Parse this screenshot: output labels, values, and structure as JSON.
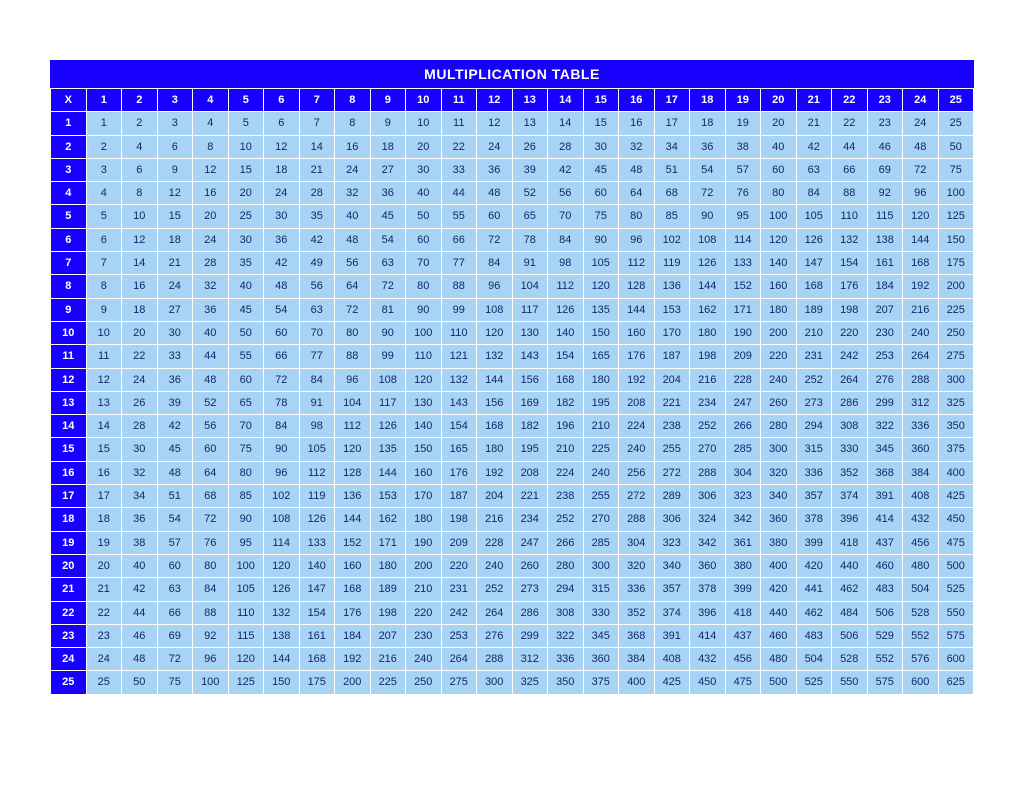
{
  "title": "MULTIPLICATION TABLE",
  "corner_label": "X",
  "size": 25,
  "chart_data": {
    "type": "table",
    "title": "MULTIPLICATION TABLE",
    "row_headers": [
      1,
      2,
      3,
      4,
      5,
      6,
      7,
      8,
      9,
      10,
      11,
      12,
      13,
      14,
      15,
      16,
      17,
      18,
      19,
      20,
      21,
      22,
      23,
      24,
      25
    ],
    "col_headers": [
      1,
      2,
      3,
      4,
      5,
      6,
      7,
      8,
      9,
      10,
      11,
      12,
      13,
      14,
      15,
      16,
      17,
      18,
      19,
      20,
      21,
      22,
      23,
      24,
      25
    ],
    "values": [
      [
        1,
        2,
        3,
        4,
        5,
        6,
        7,
        8,
        9,
        10,
        11,
        12,
        13,
        14,
        15,
        16,
        17,
        18,
        19,
        20,
        21,
        22,
        23,
        24,
        25
      ],
      [
        2,
        4,
        6,
        8,
        10,
        12,
        14,
        16,
        18,
        20,
        22,
        24,
        26,
        28,
        30,
        32,
        34,
        36,
        38,
        40,
        42,
        44,
        46,
        48,
        50
      ],
      [
        3,
        6,
        9,
        12,
        15,
        18,
        21,
        24,
        27,
        30,
        33,
        36,
        39,
        42,
        45,
        48,
        51,
        54,
        57,
        60,
        63,
        66,
        69,
        72,
        75
      ],
      [
        4,
        8,
        12,
        16,
        20,
        24,
        28,
        32,
        36,
        40,
        44,
        48,
        52,
        56,
        60,
        64,
        68,
        72,
        76,
        80,
        84,
        88,
        92,
        96,
        100
      ],
      [
        5,
        10,
        15,
        20,
        25,
        30,
        35,
        40,
        45,
        50,
        55,
        60,
        65,
        70,
        75,
        80,
        85,
        90,
        95,
        100,
        105,
        110,
        115,
        120,
        125
      ],
      [
        6,
        12,
        18,
        24,
        30,
        36,
        42,
        48,
        54,
        60,
        66,
        72,
        78,
        84,
        90,
        96,
        102,
        108,
        114,
        120,
        126,
        132,
        138,
        144,
        150
      ],
      [
        7,
        14,
        21,
        28,
        35,
        42,
        49,
        56,
        63,
        70,
        77,
        84,
        91,
        98,
        105,
        112,
        119,
        126,
        133,
        140,
        147,
        154,
        161,
        168,
        175
      ],
      [
        8,
        16,
        24,
        32,
        40,
        48,
        56,
        64,
        72,
        80,
        88,
        96,
        104,
        112,
        120,
        128,
        136,
        144,
        152,
        160,
        168,
        176,
        184,
        192,
        200
      ],
      [
        9,
        18,
        27,
        36,
        45,
        54,
        63,
        72,
        81,
        90,
        99,
        108,
        117,
        126,
        135,
        144,
        153,
        162,
        171,
        180,
        189,
        198,
        207,
        216,
        225
      ],
      [
        10,
        20,
        30,
        40,
        50,
        60,
        70,
        80,
        90,
        100,
        110,
        120,
        130,
        140,
        150,
        160,
        170,
        180,
        190,
        200,
        210,
        220,
        230,
        240,
        250
      ],
      [
        11,
        22,
        33,
        44,
        55,
        66,
        77,
        88,
        99,
        110,
        121,
        132,
        143,
        154,
        165,
        176,
        187,
        198,
        209,
        220,
        231,
        242,
        253,
        264,
        275
      ],
      [
        12,
        24,
        36,
        48,
        60,
        72,
        84,
        96,
        108,
        120,
        132,
        144,
        156,
        168,
        180,
        192,
        204,
        216,
        228,
        240,
        252,
        264,
        276,
        288,
        300
      ],
      [
        13,
        26,
        39,
        52,
        65,
        78,
        91,
        104,
        117,
        130,
        143,
        156,
        169,
        182,
        195,
        208,
        221,
        234,
        247,
        260,
        273,
        286,
        299,
        312,
        325
      ],
      [
        14,
        28,
        42,
        56,
        70,
        84,
        98,
        112,
        126,
        140,
        154,
        168,
        182,
        196,
        210,
        224,
        238,
        252,
        266,
        280,
        294,
        308,
        322,
        336,
        350
      ],
      [
        15,
        30,
        45,
        60,
        75,
        90,
        105,
        120,
        135,
        150,
        165,
        180,
        195,
        210,
        225,
        240,
        255,
        270,
        285,
        300,
        315,
        330,
        345,
        360,
        375
      ],
      [
        16,
        32,
        48,
        64,
        80,
        96,
        112,
        128,
        144,
        160,
        176,
        192,
        208,
        224,
        240,
        256,
        272,
        288,
        304,
        320,
        336,
        352,
        368,
        384,
        400
      ],
      [
        17,
        34,
        51,
        68,
        85,
        102,
        119,
        136,
        153,
        170,
        187,
        204,
        221,
        238,
        255,
        272,
        289,
        306,
        323,
        340,
        357,
        374,
        391,
        408,
        425
      ],
      [
        18,
        36,
        54,
        72,
        90,
        108,
        126,
        144,
        162,
        180,
        198,
        216,
        234,
        252,
        270,
        288,
        306,
        324,
        342,
        360,
        378,
        396,
        414,
        432,
        450
      ],
      [
        19,
        38,
        57,
        76,
        95,
        114,
        133,
        152,
        171,
        190,
        209,
        228,
        247,
        266,
        285,
        304,
        323,
        342,
        361,
        380,
        399,
        418,
        437,
        456,
        475
      ],
      [
        20,
        40,
        60,
        80,
        100,
        120,
        140,
        160,
        180,
        200,
        220,
        240,
        260,
        280,
        300,
        320,
        340,
        360,
        380,
        400,
        420,
        440,
        460,
        480,
        500
      ],
      [
        21,
        42,
        63,
        84,
        105,
        126,
        147,
        168,
        189,
        210,
        231,
        252,
        273,
        294,
        315,
        336,
        357,
        378,
        399,
        420,
        441,
        462,
        483,
        504,
        525
      ],
      [
        22,
        44,
        66,
        88,
        110,
        132,
        154,
        176,
        198,
        220,
        242,
        264,
        286,
        308,
        330,
        352,
        374,
        396,
        418,
        440,
        462,
        484,
        506,
        528,
        550
      ],
      [
        23,
        46,
        69,
        92,
        115,
        138,
        161,
        184,
        207,
        230,
        253,
        276,
        299,
        322,
        345,
        368,
        391,
        414,
        437,
        460,
        483,
        506,
        529,
        552,
        575
      ],
      [
        24,
        48,
        72,
        96,
        120,
        144,
        168,
        192,
        216,
        240,
        264,
        288,
        312,
        336,
        360,
        384,
        408,
        432,
        456,
        480,
        504,
        528,
        552,
        576,
        600
      ],
      [
        25,
        50,
        75,
        100,
        125,
        150,
        175,
        200,
        225,
        250,
        275,
        300,
        325,
        350,
        375,
        400,
        425,
        450,
        475,
        500,
        525,
        550,
        575,
        600,
        625
      ]
    ]
  }
}
